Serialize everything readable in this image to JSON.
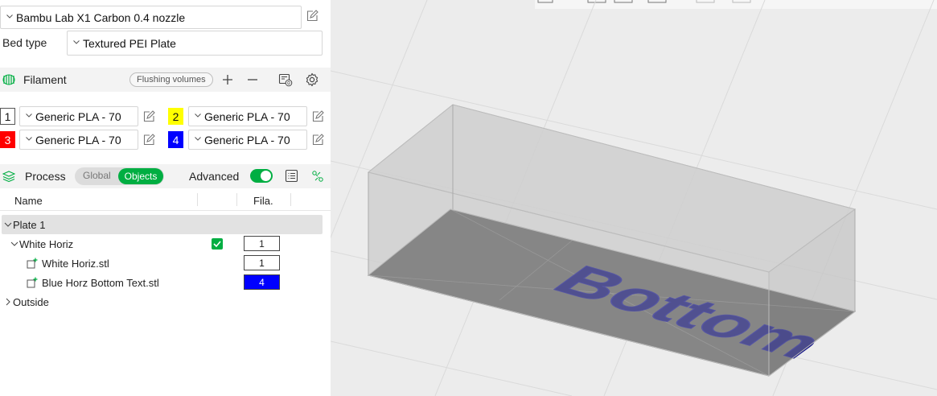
{
  "printer": {
    "value": "Bambu Lab X1 Carbon 0.4 nozzle"
  },
  "bed_type": {
    "label": "Bed type",
    "value": "Textured PEI Plate"
  },
  "filament": {
    "title": "Filament",
    "flushing_label": "Flushing volumes",
    "slots": [
      {
        "num": "1",
        "color": "#ffffff",
        "text_color": "#111111",
        "value": "Generic PLA - 70"
      },
      {
        "num": "2",
        "color": "#ffff00",
        "text_color": "#111111",
        "value": "Generic PLA - 70"
      },
      {
        "num": "3",
        "color": "#ff0000",
        "text_color": "#ffffff",
        "value": "Generic PLA - 70"
      },
      {
        "num": "4",
        "color": "#0000ff",
        "text_color": "#ffffff",
        "value": "Generic PLA - 70"
      }
    ]
  },
  "process": {
    "title": "Process",
    "global_label": "Global",
    "objects_label": "Objects",
    "advanced_label": "Advanced",
    "advanced_on": true
  },
  "object_list": {
    "columns": {
      "name": "Name",
      "fila": "Fila."
    },
    "plate": "Plate 1",
    "object": {
      "name": "White Horiz",
      "fila": "1",
      "checked": true
    },
    "parts": [
      {
        "name": "White Horiz.stl",
        "fila": "1",
        "fila_color": "#ffffff",
        "fila_text_color": "#111111"
      },
      {
        "name": "Blue Horz Bottom Text.stl",
        "fila": "4",
        "fila_color": "#0000ff",
        "fila_text_color": "#ffffff"
      }
    ],
    "outside": "Outside"
  },
  "viewport": {
    "model_text": "Bottom",
    "text_color": "#0b0b6e"
  },
  "colors": {
    "accent": "#00ae42"
  }
}
